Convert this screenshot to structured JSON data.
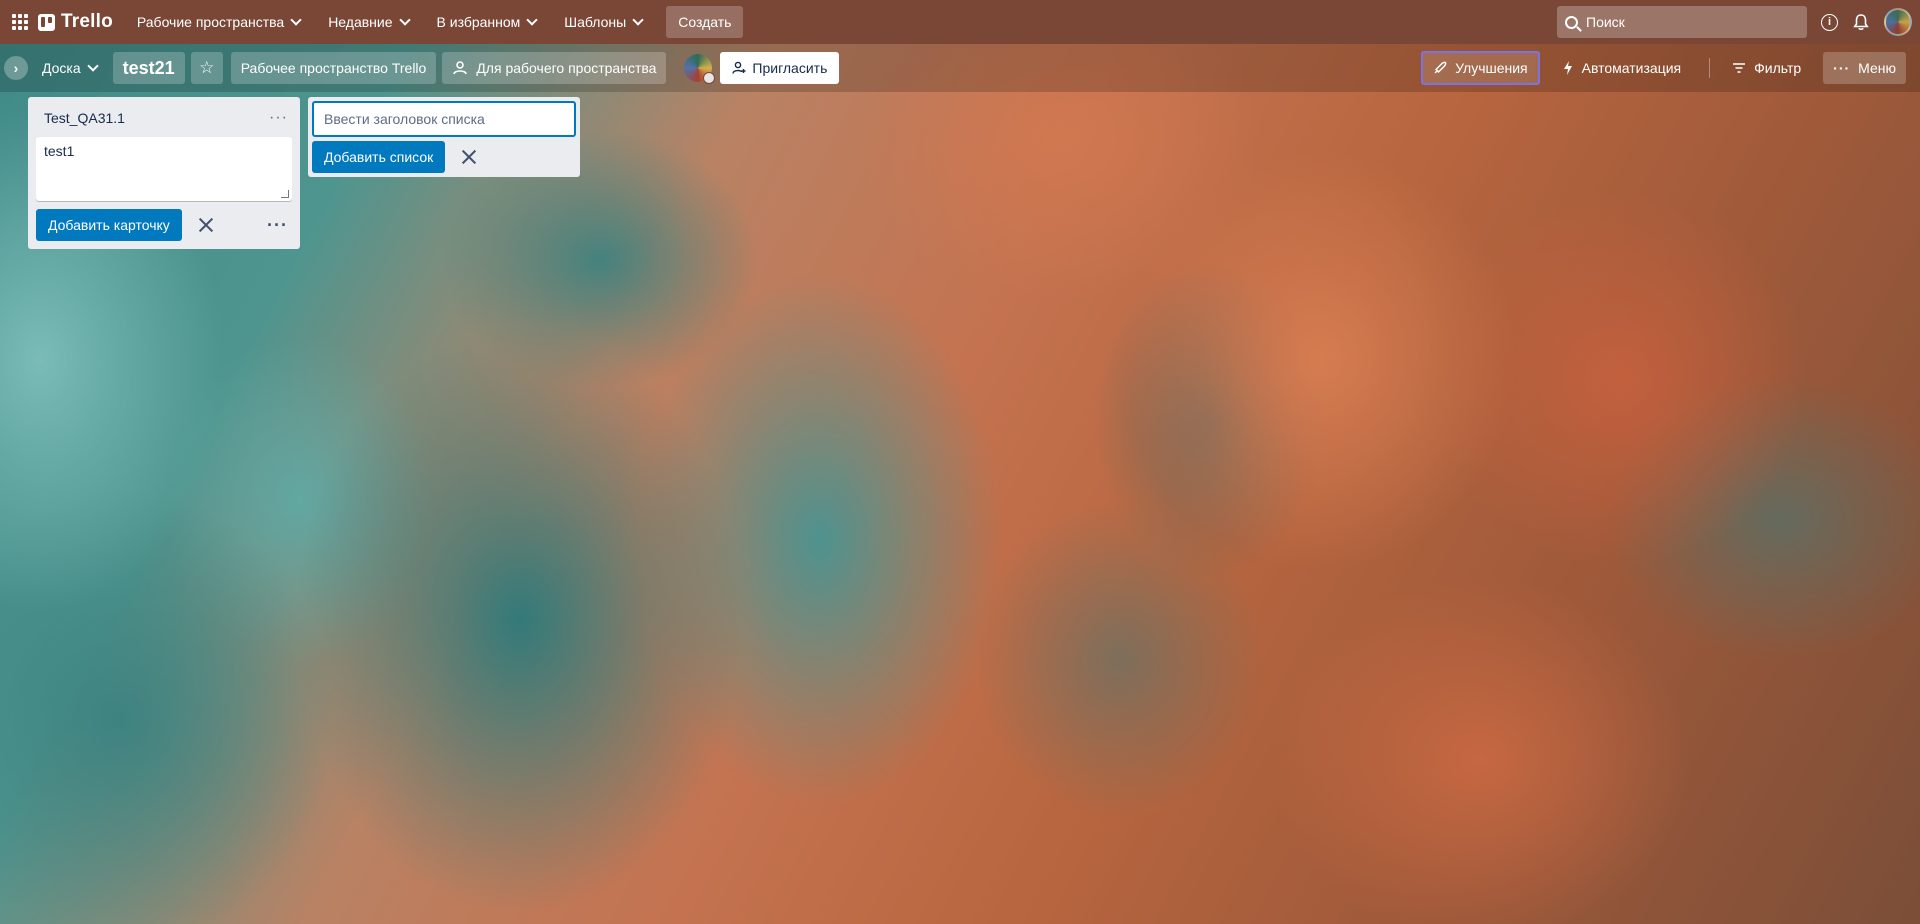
{
  "topbar": {
    "logo": "Trello",
    "nav": [
      {
        "label": "Рабочие пространства"
      },
      {
        "label": "Недавние"
      },
      {
        "label": "В избранном"
      },
      {
        "label": "Шаблоны"
      }
    ],
    "create_label": "Создать",
    "search_placeholder": "Поиск",
    "icons": [
      "apps-icon",
      "info-icon",
      "bell-icon",
      "avatar"
    ]
  },
  "board_header": {
    "view_label": "Доска",
    "board_title": "test21",
    "workspace_label": "Рабочее пространство Trello",
    "visibility_label": "Для рабочего пространства",
    "invite_label": "Пригласить",
    "upgrades_label": "Улучшения",
    "automation_label": "Автоматизация",
    "filter_label": "Фильтр",
    "menu_label": "Меню"
  },
  "lists": [
    {
      "title": "Test_QA31.1",
      "composer_text": "test1",
      "add_card_label": "Добавить карточку"
    }
  ],
  "new_list": {
    "placeholder": "Ввести заголовок списка",
    "add_label": "Добавить список"
  },
  "colors": {
    "topbar_bg": "#7a4736",
    "primary_button": "#0079bf",
    "list_bg": "#ebecf0",
    "upgrades_outline": "#7c72e8"
  }
}
